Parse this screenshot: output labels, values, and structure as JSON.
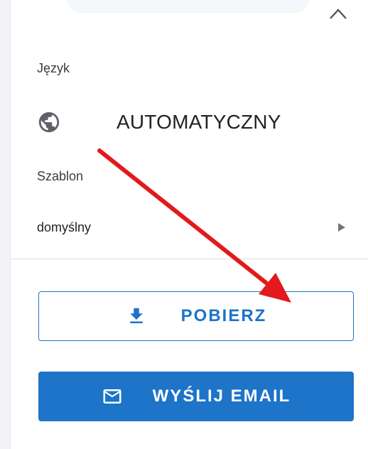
{
  "language": {
    "label": "Język",
    "value": "AUTOMATYCZNY",
    "icon": "globe-icon"
  },
  "template": {
    "label": "Szablon",
    "value": "domyślny",
    "icon": "chevron-right-icon"
  },
  "actions": {
    "download_label": "POBIERZ",
    "email_label": "WYŚLIJ EMAIL"
  },
  "colors": {
    "primary": "#1d74c8",
    "annotation_arrow": "#e3191b"
  }
}
